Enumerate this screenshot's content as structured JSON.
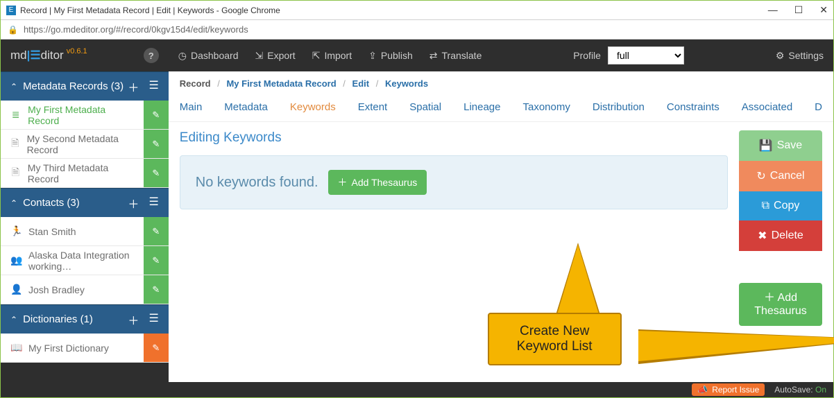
{
  "window": {
    "title": "Record | My First Metadata Record | Edit | Keywords - Google Chrome",
    "url": "https://go.mdeditor.org/#/record/0kgv15d4/edit/keywords"
  },
  "brand": {
    "name_prefix": "md",
    "name_mid": "E",
    "name_suffix": "ditor",
    "version": "v0.6.1"
  },
  "sidebar": {
    "sections": [
      {
        "title": "Metadata Records (3)",
        "items": [
          {
            "label": "My First Metadata Record",
            "icon": "database",
            "active": true
          },
          {
            "label": "My Second Metadata Record",
            "icon": "file"
          },
          {
            "label": "My Third Metadata Record",
            "icon": "file"
          }
        ]
      },
      {
        "title": "Contacts (3)",
        "items": [
          {
            "label": "Stan Smith",
            "icon": "person-run"
          },
          {
            "label": "Alaska Data Integration working…",
            "icon": "group"
          },
          {
            "label": "Josh Bradley",
            "icon": "person"
          }
        ]
      },
      {
        "title": "Dictionaries (1)",
        "items": [
          {
            "label": "My First Dictionary",
            "icon": "book",
            "edit_color": "orange"
          }
        ]
      }
    ]
  },
  "topnav": {
    "items": [
      {
        "label": "Dashboard",
        "icon": "gauge"
      },
      {
        "label": "Export",
        "icon": "signout"
      },
      {
        "label": "Import",
        "icon": "signin"
      },
      {
        "label": "Publish",
        "icon": "share"
      },
      {
        "label": "Translate",
        "icon": "transfer"
      }
    ],
    "profile_label": "Profile",
    "profile_value": "full",
    "settings_label": "Settings"
  },
  "breadcrumb": [
    "Record",
    "My First Metadata Record",
    "Edit",
    "Keywords"
  ],
  "subnav": [
    "Main",
    "Metadata",
    "Keywords",
    "Extent",
    "Spatial",
    "Lineage",
    "Taxonomy",
    "Distribution",
    "Constraints",
    "Associated",
    "D"
  ],
  "subnav_active": 2,
  "page": {
    "title": "Editing Keywords",
    "empty_msg": "No keywords found.",
    "add_thesaurus_btn": "Add Thesaurus"
  },
  "actions": {
    "save": "Save",
    "cancel": "Cancel",
    "copy": "Copy",
    "delete": "Delete",
    "add_thesaurus_big": "Add Thesaurus"
  },
  "callout": {
    "line1": "Create New",
    "line2": "Keyword List"
  },
  "statusbar": {
    "report": "Report Issue",
    "autosave_label": "AutoSave:",
    "autosave_value": "On"
  }
}
